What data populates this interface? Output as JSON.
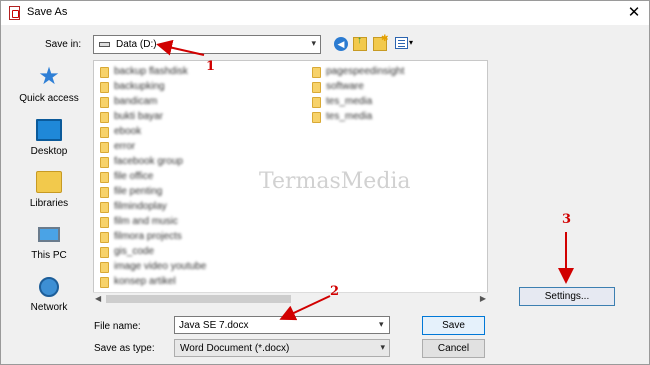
{
  "window": {
    "title": "Save As",
    "close_glyph": "✕"
  },
  "toolbar": {
    "save_in_label": "Save in:",
    "save_in_value": "Data (D:)",
    "icons": [
      "back-icon",
      "up-folder-icon",
      "new-folder-icon",
      "views-menu-icon"
    ]
  },
  "places": [
    {
      "label": "Quick access",
      "icon": "quick-access-icon"
    },
    {
      "label": "Desktop",
      "icon": "desktop-icon"
    },
    {
      "label": "Libraries",
      "icon": "libraries-icon"
    },
    {
      "label": "This PC",
      "icon": "this-pc-icon"
    },
    {
      "label": "Network",
      "icon": "network-icon"
    }
  ],
  "files_col1": [
    "backup flashdisk",
    "backupking",
    "bandicam",
    "bukti bayar",
    "ebook",
    "error",
    "facebook group",
    "file office",
    "file penting",
    "filmindoplay",
    "film and music",
    "filmora projects",
    "gis_code",
    "image video youtube",
    "konsep artikel"
  ],
  "files_col2": [
    "pagespeedinsight",
    "software",
    "tes_media",
    "tes_media"
  ],
  "watermark": "TermasMedia",
  "settings_label": "Settings...",
  "file_name": {
    "label": "File name:",
    "value": "Java SE 7.docx"
  },
  "save_as_type": {
    "label": "Save as type:",
    "value": "Word Document (*.docx)"
  },
  "buttons": {
    "save": "Save",
    "cancel": "Cancel"
  },
  "annotations": [
    "1",
    "2",
    "3"
  ],
  "colors": {
    "accent": "#0078d7",
    "annotation": "#d10000"
  }
}
